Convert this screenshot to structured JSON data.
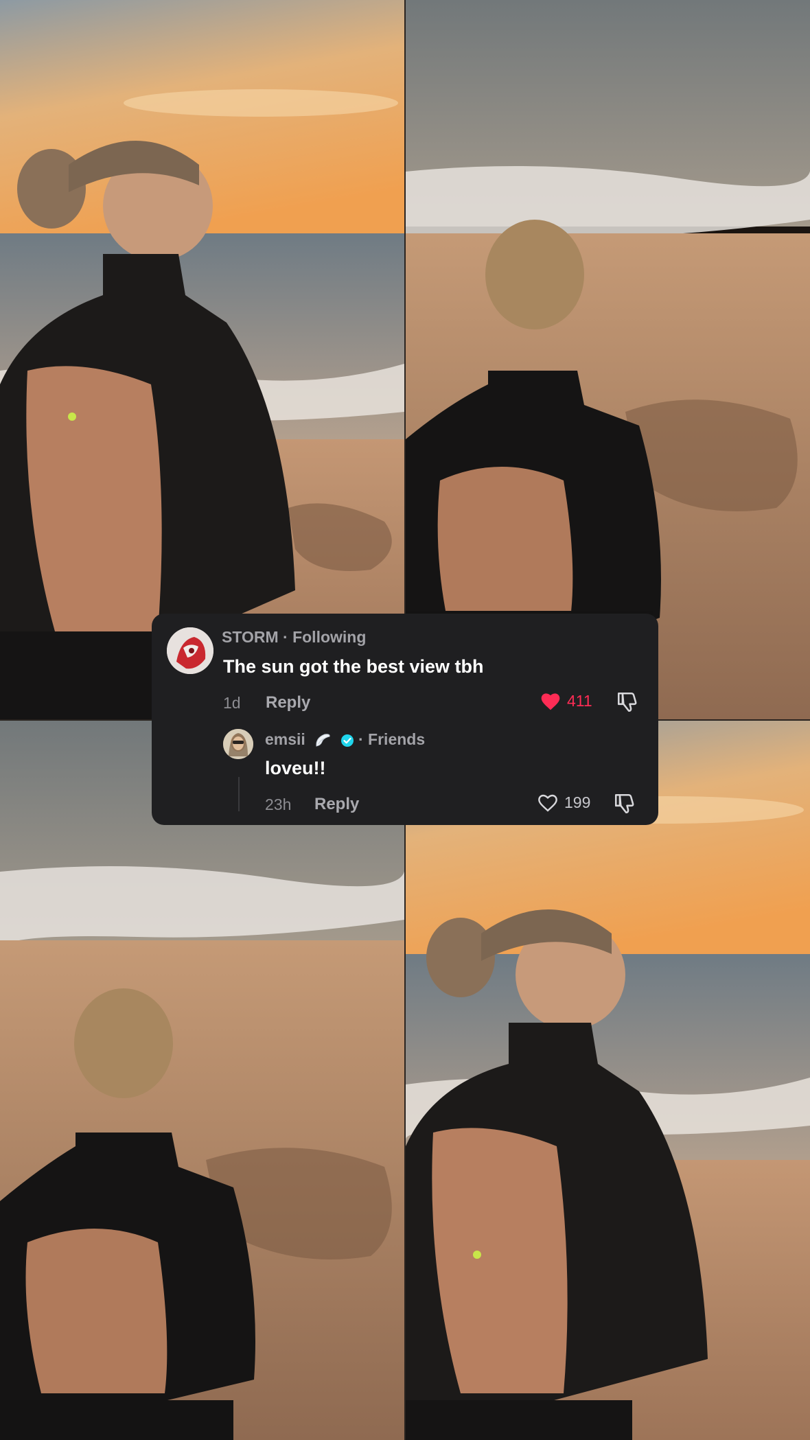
{
  "comment": {
    "username": "STORM",
    "relation": "· Following",
    "text": "The sun got the best view tbh",
    "age": "1d",
    "reply_label": "Reply",
    "likes": "411",
    "liked": true
  },
  "reply": {
    "username": "emsii",
    "relation": "· Friends",
    "text": "loveu!!",
    "age": "23h",
    "reply_label": "Reply",
    "likes": "199",
    "liked": false
  },
  "icons": {
    "like_filled": "heart-filled-icon",
    "like_outline": "heart-outline-icon",
    "dislike": "thumbs-down-icon",
    "verified": "verified-badge-icon",
    "wing": "angel-wing-emoji-icon"
  },
  "colors": {
    "card_bg": "#1f1f21",
    "like_active": "#fe2c55",
    "verified": "#20d5ec"
  }
}
